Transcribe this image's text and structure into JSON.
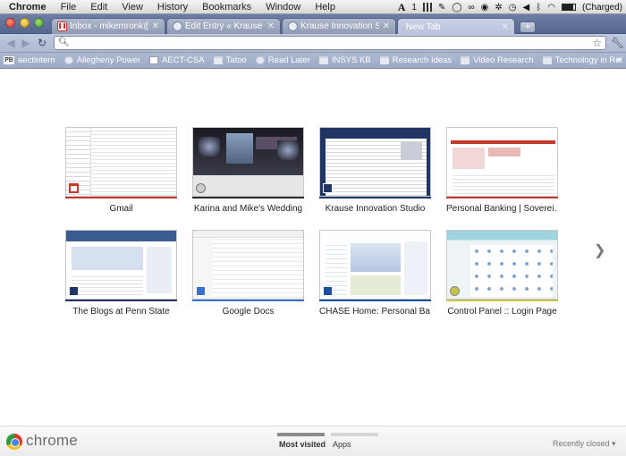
{
  "menubar": {
    "app_name": "Chrome",
    "items": [
      "File",
      "Edit",
      "View",
      "History",
      "Bookmarks",
      "Window",
      "Help"
    ],
    "status": {
      "adobe_count": "1",
      "battery_text": "(Charged)"
    }
  },
  "tabs": [
    {
      "title": "Inbox - mikemronk@gmail.c",
      "favicon": "gmail-icon",
      "active": false
    },
    {
      "title": "Edit Entry « Krause Innovatio",
      "favicon": "page-icon",
      "active": false
    },
    {
      "title": "Krause Innovation Studio | Pe",
      "favicon": "page-icon",
      "active": false
    },
    {
      "title": "New Tab",
      "favicon": "",
      "active": true
    }
  ],
  "toolbar": {
    "address_value": "",
    "address_placeholder": ""
  },
  "bookmarks": [
    {
      "label": "aectintern",
      "icon": "pb"
    },
    {
      "label": "Allegheny Power",
      "icon": "globe"
    },
    {
      "label": "AECT-CSA",
      "icon": "page"
    },
    {
      "label": "Tatoo",
      "icon": "folder"
    },
    {
      "label": "Read Later",
      "icon": "globe"
    },
    {
      "label": "INSYS KB",
      "icon": "folder"
    },
    {
      "label": "Research Ideas",
      "icon": "folder"
    },
    {
      "label": "Video Research",
      "icon": "folder"
    },
    {
      "label": "Technology in Rel",
      "icon": "folder"
    }
  ],
  "thumbnails": [
    {
      "label": "Gmail",
      "accent": "#c5392a"
    },
    {
      "label": "Karina and Mike's Wedding",
      "accent": "#2a2a2a"
    },
    {
      "label": "Krause Innovation Studio",
      "accent": "#1f3563"
    },
    {
      "label": "Personal Banking | Soverei…",
      "accent": "#c0392b"
    },
    {
      "label": "The Blogs at Penn State",
      "accent": "#1f3563"
    },
    {
      "label": "Google Docs",
      "accent": "#3b6fcf"
    },
    {
      "label": "CHASE Home: Personal Ba…",
      "accent": "#1c4fa3"
    },
    {
      "label": "Control Panel :: Login Page",
      "accent": "#c7c24a"
    }
  ],
  "footer": {
    "logo_text": "chrome",
    "tab_most_visited": "Most visited",
    "tab_apps": "Apps",
    "recently_closed": "Recently closed ▾"
  }
}
